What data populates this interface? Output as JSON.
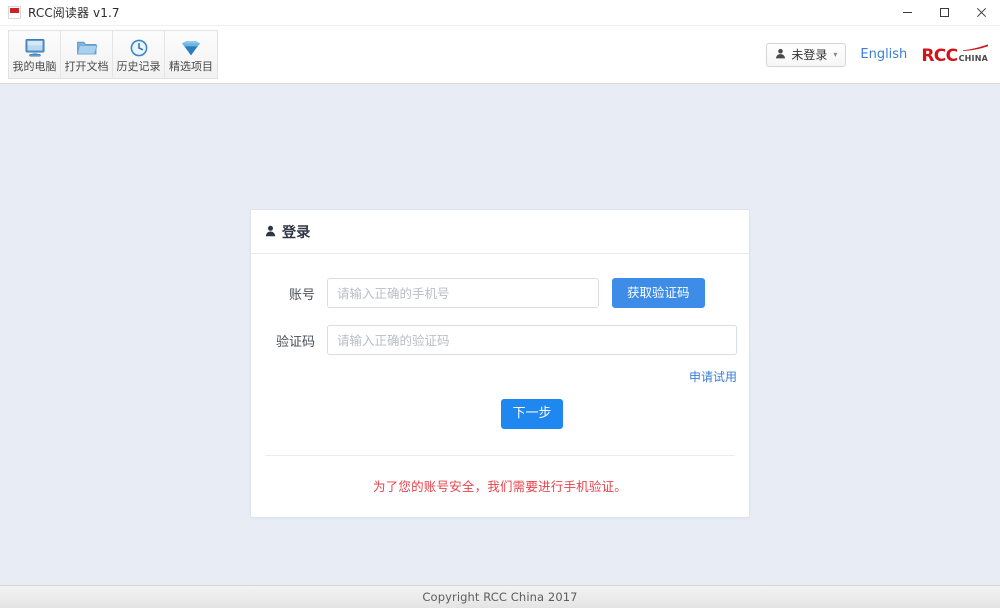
{
  "window": {
    "title": "RCC阅读器 v1.7",
    "app_icon": "rcc-app-icon",
    "controls": {
      "minimize": "minimize-icon",
      "maximize": "maximize-icon",
      "close": "close-icon"
    }
  },
  "toolbar": {
    "buttons": [
      {
        "label": "我的电脑",
        "icon": "monitor-icon"
      },
      {
        "label": "打开文档",
        "icon": "folder-icon"
      },
      {
        "label": "历史记录",
        "icon": "clock-icon"
      },
      {
        "label": "精选项目",
        "icon": "diamond-icon"
      }
    ],
    "user": {
      "label": "未登录",
      "icon": "user-icon",
      "caret": "▾"
    },
    "language_link": "English",
    "brand": {
      "name": "RCC",
      "suffix": "CHINA",
      "color": "#d3121a"
    }
  },
  "login_card": {
    "header": {
      "title": "登录",
      "icon": "user-icon"
    },
    "account": {
      "label": "账号",
      "placeholder": "请输入正确的手机号",
      "value": ""
    },
    "get_code_button": "获取验证码",
    "captcha": {
      "label": "验证码",
      "placeholder": "请输入正确的验证码",
      "value": ""
    },
    "trial_link": "申请试用",
    "next_button": "下一步",
    "notice": "为了您的账号安全，我们需要进行手机验证。"
  },
  "footer": {
    "copyright": "Copyright RCC China 2017"
  },
  "colors": {
    "accent_blue": "#3d8ce8",
    "primary_blue": "#1e87f0",
    "link_blue": "#3a7fd5",
    "notice_red": "#e8434b",
    "brand_red": "#d3121a",
    "page_bg": "#e8edf5"
  }
}
